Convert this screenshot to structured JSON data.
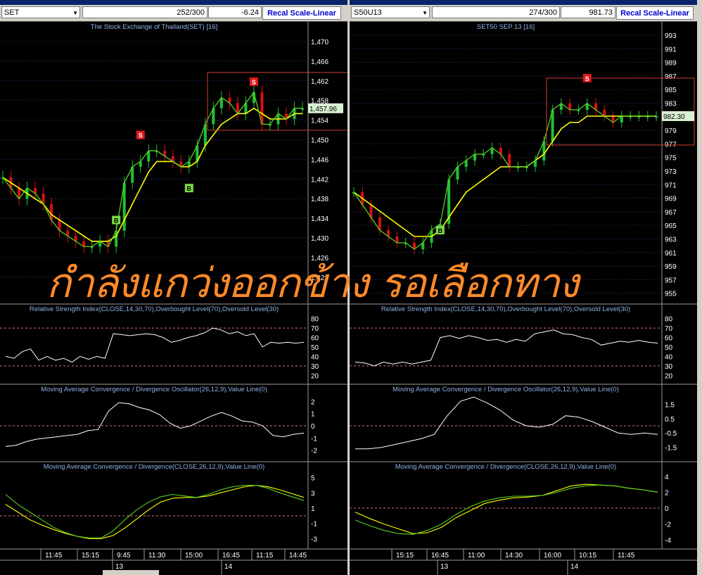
{
  "overlay_text": "กำลังแกว่งออกข้าง รอเลือกทาง",
  "colors": {
    "price_line": "#ffff00",
    "fast_line": "#58d020",
    "up": "#22c032",
    "down": "#d81010",
    "indicator": "#ffffff",
    "grid": "#2a2a6a",
    "level": "#e07070",
    "box": "#d04030",
    "axis_text": "#ffffff",
    "title_text": "#8fb0e8"
  },
  "panels": [
    {
      "symbol": "SET",
      "counter": "252/300",
      "value": "-6.24",
      "recal_label": "Recal Scale-Linear",
      "title": "The Stock Exchange of Thailand(SET) [16]",
      "current_price": "1,457.96",
      "price_axis": [
        "1,470",
        "1,466",
        "1,462",
        "1,458",
        "1,454",
        "1,450",
        "1,446",
        "1,442",
        "1,438",
        "1,434",
        "1,430",
        "1,426",
        "1,422"
      ],
      "signals": [
        {
          "label": "S",
          "kind": "sell"
        },
        {
          "label": "S",
          "kind": "sell"
        },
        {
          "label": "B",
          "kind": "buy"
        },
        {
          "label": "B",
          "kind": "buy"
        }
      ],
      "rsi_title": "Relative Strength Index(CLOSE,14,30,70),Overbought Level(70),Oversold Level(30)",
      "rsi_axis": [
        "80",
        "70",
        "60",
        "50",
        "40",
        "30",
        "20"
      ],
      "osc_title": "Moving Average Convergence / Divergence Oscillator(26,12,9),Value Line(0)",
      "osc_axis": [
        "2",
        "1",
        "0",
        "-1",
        "-2"
      ],
      "macd_title": "Moving Average Convergence / Divergence(CLOSE,26,12,9),Value Line(0)",
      "macd_axis": [
        "5",
        "3",
        "1",
        "-1",
        "-3"
      ],
      "time_labels": [
        "11:45",
        "15:15",
        "9:45",
        "11:30",
        "15:00",
        "16:45",
        "11:15",
        "14:45"
      ],
      "date_labels": [
        "13",
        "14"
      ]
    },
    {
      "symbol": "S50U13",
      "counter": "274/300",
      "value": "981.73",
      "recal_label": "Recal Scale-Linear",
      "title": "SET50 SEP 13  [16]",
      "current_price": "982.30",
      "price_axis": [
        "993",
        "991",
        "989",
        "987",
        "985",
        "983",
        "981",
        "979",
        "977",
        "975",
        "973",
        "971",
        "969",
        "967",
        "965",
        "963",
        "961",
        "959",
        "957",
        "955"
      ],
      "signals": [
        {
          "label": "S",
          "kind": "sell"
        },
        {
          "label": "B",
          "kind": "buy"
        }
      ],
      "rsi_title": "Relative Strength Index(CLOSE,14,30,70),Overbought Level(70),Oversold Level(30)",
      "rsi_axis": [
        "80",
        "70",
        "60",
        "50",
        "40",
        "30",
        "20"
      ],
      "osc_title": "Moving Average Convergence / Divergence Oscillator(26,12,9),Value Line(0)",
      "osc_axis": [
        "1.5",
        "0.5",
        "-0.5",
        "-1.5"
      ],
      "macd_title": "Moving Average Convergence / Divergence(CLOSE,26,12,9),Value Line(0)",
      "macd_axis": [
        "4",
        "2",
        "0",
        "-2",
        "-4"
      ],
      "time_labels": [
        "15:15",
        "16:45",
        "11:00",
        "14:30",
        "16:00",
        "10:15",
        "11:45"
      ],
      "date_labels": [
        "13",
        "14"
      ]
    }
  ],
  "chart_data": [
    {
      "type": "line",
      "title": "The Stock Exchange of Thailand(SET) [16]",
      "ylim": [
        1422,
        1472
      ],
      "close": [
        1445,
        1443,
        1441,
        1443,
        1442,
        1440,
        1437,
        1435,
        1434,
        1433,
        1432,
        1432,
        1433,
        1432,
        1435,
        1444,
        1447,
        1448,
        1450,
        1450,
        1449,
        1448,
        1447,
        1448,
        1451,
        1455,
        1458,
        1460,
        1459,
        1457,
        1459,
        1461,
        1455,
        1455,
        1457,
        1456,
        1458,
        1458
      ],
      "ema_slow": [
        1445,
        1444,
        1443,
        1442,
        1441,
        1440,
        1438,
        1437,
        1436,
        1435,
        1434,
        1433,
        1433,
        1433,
        1434,
        1437,
        1440,
        1443,
        1446,
        1448,
        1448,
        1448,
        1447,
        1447,
        1448,
        1451,
        1453,
        1455,
        1456,
        1457,
        1457,
        1458,
        1457,
        1456,
        1456,
        1456,
        1457,
        1457
      ],
      "signals": [
        {
          "i": 14,
          "type": "B",
          "price": 1437
        },
        {
          "i": 17,
          "type": "S",
          "price": 1453
        },
        {
          "i": 23,
          "type": "B",
          "price": 1443
        },
        {
          "i": 31,
          "type": "S",
          "price": 1463
        }
      ],
      "rsi": [
        40,
        38,
        45,
        48,
        36,
        40,
        36,
        38,
        34,
        40,
        37,
        40,
        38,
        64,
        63,
        62,
        63,
        64,
        63,
        60,
        55,
        57,
        60,
        62,
        65,
        70,
        68,
        64,
        66,
        62,
        64,
        50,
        55,
        54,
        55,
        54,
        55
      ],
      "rsi_ylim": [
        15,
        85
      ],
      "rsi_levels": [
        70,
        30
      ],
      "oscillator": [
        -1.7,
        -1.6,
        -1.3,
        -1.1,
        -1.0,
        -0.9,
        -0.8,
        -0.7,
        -0.4,
        -0.3,
        1.2,
        1.9,
        1.8,
        1.5,
        1.3,
        0.9,
        0.2,
        -0.2,
        0.0,
        0.4,
        0.8,
        1.1,
        0.8,
        0.4,
        0.3,
        0.0,
        -0.8,
        -0.9,
        -0.7,
        -0.6
      ],
      "osc_ylim": [
        -2.6,
        2.6
      ],
      "macd": [
        2.8,
        1.5,
        0.5,
        -0.5,
        -1.5,
        -2.2,
        -2.7,
        -2.9,
        -2.9,
        -2.0,
        -0.5,
        0.8,
        1.8,
        2.5,
        2.8,
        2.6,
        2.4,
        2.8,
        3.4,
        3.8,
        4.0,
        4.0,
        3.6,
        3.0,
        2.5,
        2.0
      ],
      "signal": [
        1.5,
        0.5,
        -0.5,
        -1.2,
        -1.8,
        -2.3,
        -2.7,
        -3.0,
        -3.0,
        -2.6,
        -1.6,
        -0.4,
        0.8,
        1.8,
        2.3,
        2.4,
        2.4,
        2.6,
        3.0,
        3.4,
        3.8,
        4.0,
        3.8,
        3.4,
        2.9,
        2.4
      ],
      "macd_ylim": [
        -3.8,
        5.8
      ]
    },
    {
      "type": "line",
      "title": "SET50 SEP 13  [16]",
      "ylim": [
        953,
        995
      ],
      "close": [
        970,
        968,
        966,
        964,
        963,
        962,
        962,
        961,
        962,
        964,
        965,
        972,
        974,
        975,
        976,
        976,
        977,
        976,
        974,
        974,
        974,
        975,
        978,
        983,
        984,
        983,
        983,
        984,
        983,
        982,
        981,
        982,
        982,
        982,
        982,
        982
      ],
      "ema_slow": [
        970,
        969,
        968,
        967,
        966,
        965,
        964,
        963,
        963,
        963,
        964,
        966,
        968,
        970,
        971,
        972,
        973,
        974,
        974,
        974,
        974,
        975,
        976,
        978,
        980,
        981,
        981,
        982,
        982,
        982,
        982,
        982,
        982,
        982,
        982,
        982
      ],
      "signals": [
        {
          "i": 10,
          "type": "B",
          "price": 964
        },
        {
          "i": 27,
          "type": "S",
          "price": 988
        }
      ],
      "rsi": [
        34,
        33,
        30,
        34,
        32,
        34,
        32,
        34,
        36,
        60,
        62,
        59,
        62,
        60,
        57,
        58,
        55,
        58,
        56,
        64,
        66,
        68,
        64,
        63,
        60,
        58,
        52,
        54,
        56,
        55,
        57,
        55,
        54
      ],
      "rsi_ylim": [
        15,
        85
      ],
      "rsi_levels": [
        70,
        30
      ],
      "oscillator": [
        -1.6,
        -1.6,
        -1.5,
        -1.3,
        -1.1,
        -0.9,
        -0.6,
        0.7,
        1.7,
        2.0,
        1.6,
        1.1,
        0.4,
        0.0,
        -0.1,
        0.1,
        0.7,
        0.6,
        0.3,
        -0.1,
        -0.5,
        -0.6,
        -0.5,
        -0.6
      ],
      "osc_ylim": [
        -2.2,
        2.2
      ],
      "macd": [
        -1.5,
        -2.2,
        -2.8,
        -3.2,
        -3.3,
        -2.8,
        -2.0,
        -0.8,
        0.2,
        0.9,
        1.3,
        1.5,
        1.5,
        1.6,
        2.0,
        2.5,
        2.8,
        2.9,
        2.8,
        2.5,
        2.3,
        2.0
      ],
      "signal": [
        -0.5,
        -1.3,
        -2.0,
        -2.6,
        -3.2,
        -3.1,
        -2.4,
        -1.2,
        -0.3,
        0.6,
        1.0,
        1.3,
        1.4,
        1.6,
        2.2,
        2.8,
        3.0,
        2.9,
        2.8,
        2.5,
        2.3,
        2.0
      ],
      "macd_ylim": [
        -4.6,
        4.6
      ]
    }
  ]
}
